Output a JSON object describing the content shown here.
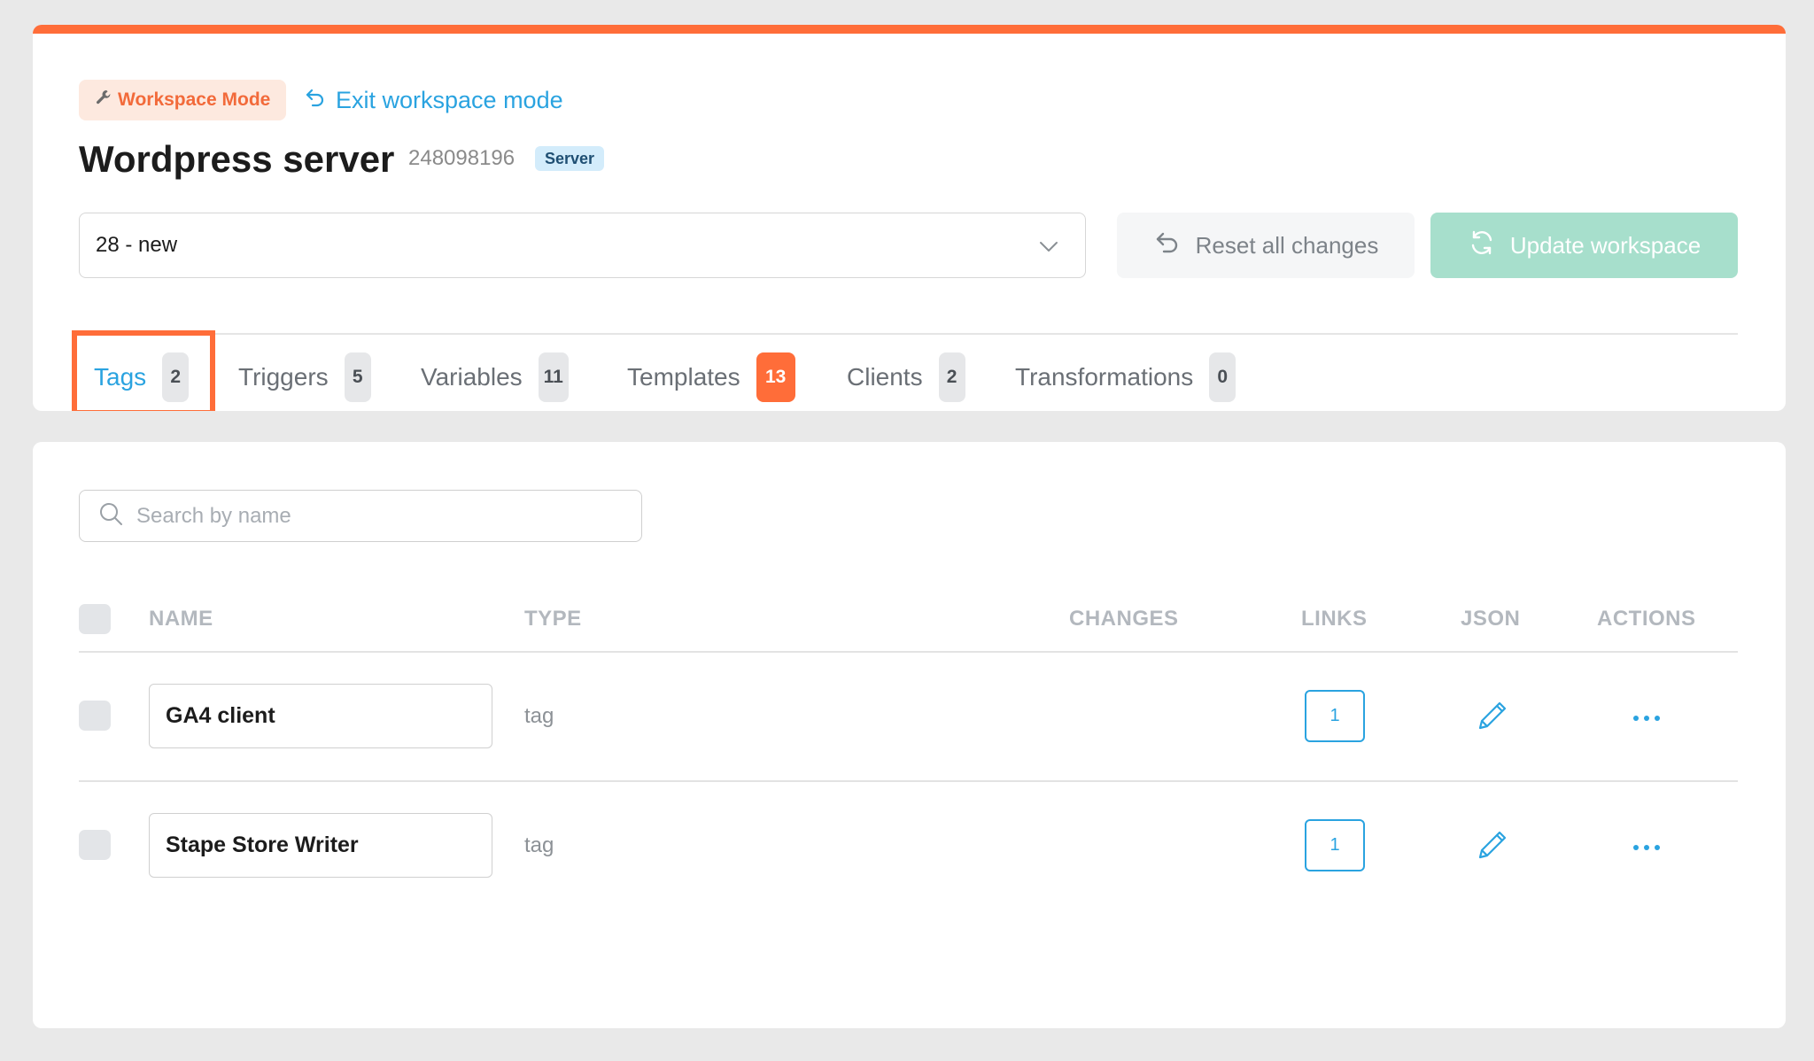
{
  "header": {
    "mode_badge": "Workspace Mode",
    "exit_link": "Exit workspace mode",
    "title": "Wordpress server",
    "server_id": "248098196",
    "server_badge": "Server"
  },
  "workspace_select": {
    "value": "28 - new"
  },
  "actions": {
    "reset": "Reset all changes",
    "update": "Update workspace"
  },
  "tabs": [
    {
      "label": "Tags",
      "count": "2",
      "active": true
    },
    {
      "label": "Triggers",
      "count": "5"
    },
    {
      "label": "Variables",
      "count": "11"
    },
    {
      "label": "Templates",
      "count": "13",
      "highlight": true
    },
    {
      "label": "Clients",
      "count": "2"
    },
    {
      "label": "Transformations",
      "count": "0"
    }
  ],
  "search": {
    "placeholder": "Search by name"
  },
  "table": {
    "columns": [
      "NAME",
      "TYPE",
      "CHANGES",
      "LINKS",
      "JSON",
      "ACTIONS"
    ],
    "rows": [
      {
        "name": "GA4 client",
        "type": "tag",
        "changes": "",
        "links": "1"
      },
      {
        "name": "Stape Store Writer",
        "type": "tag",
        "changes": "",
        "links": "1"
      }
    ]
  },
  "colors": {
    "accent": "#ff6d39",
    "link": "#2aa3e0",
    "update_button": "#a7dfcc"
  },
  "icons": [
    "wrench-icon",
    "undo-arrow-icon",
    "chevron-down-icon",
    "refresh-icon",
    "search-icon",
    "pencil-icon",
    "more-horizontal-icon"
  ]
}
